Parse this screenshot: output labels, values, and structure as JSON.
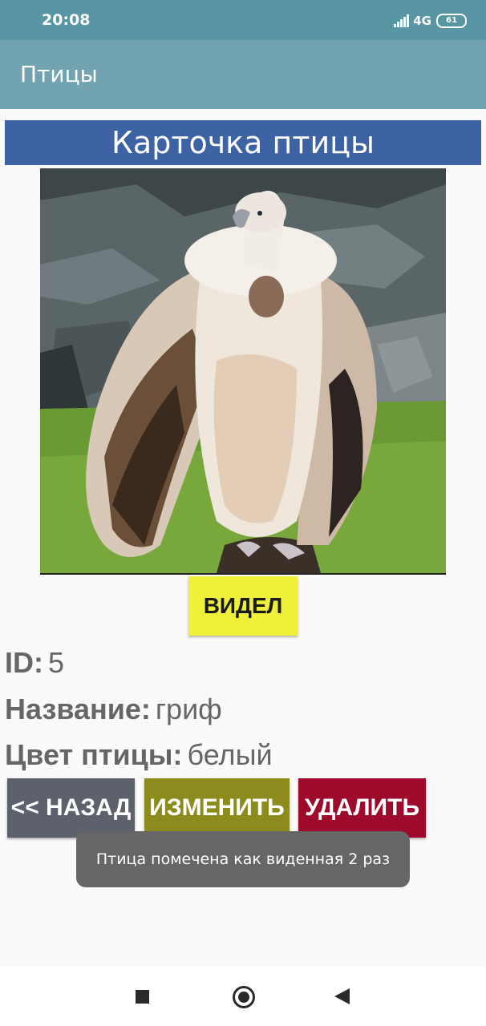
{
  "status_bar": {
    "time": "20:08",
    "network": "4G",
    "battery": "61"
  },
  "app_bar": {
    "title": "Птицы"
  },
  "card": {
    "title": "Карточка птицы",
    "photo_icon": "vulture-photo",
    "seen_button": "ВИДЕЛ",
    "fields": [
      {
        "label": "ID:",
        "value": "5"
      },
      {
        "label": "Название:",
        "value": "гриф"
      },
      {
        "label": "Цвет птицы:",
        "value": "белый"
      }
    ]
  },
  "actions": {
    "back": "<< НАЗАД",
    "edit": "ИЗМЕНИТЬ",
    "delete": "УДАЛИТЬ"
  },
  "toast": {
    "message": "Птица помечена как виденная 2 раз"
  },
  "colors": {
    "status_bar": "#5796a2",
    "app_bar": "#72a3b0",
    "card_header": "#3d63a5",
    "seen_button": "#eef03a",
    "back_button": "#5d616c",
    "edit_button": "#8c8c1e",
    "delete_button": "#9e0a2b"
  },
  "nav_bar": {
    "icons": [
      "recents-icon",
      "home-icon",
      "back-icon"
    ]
  }
}
